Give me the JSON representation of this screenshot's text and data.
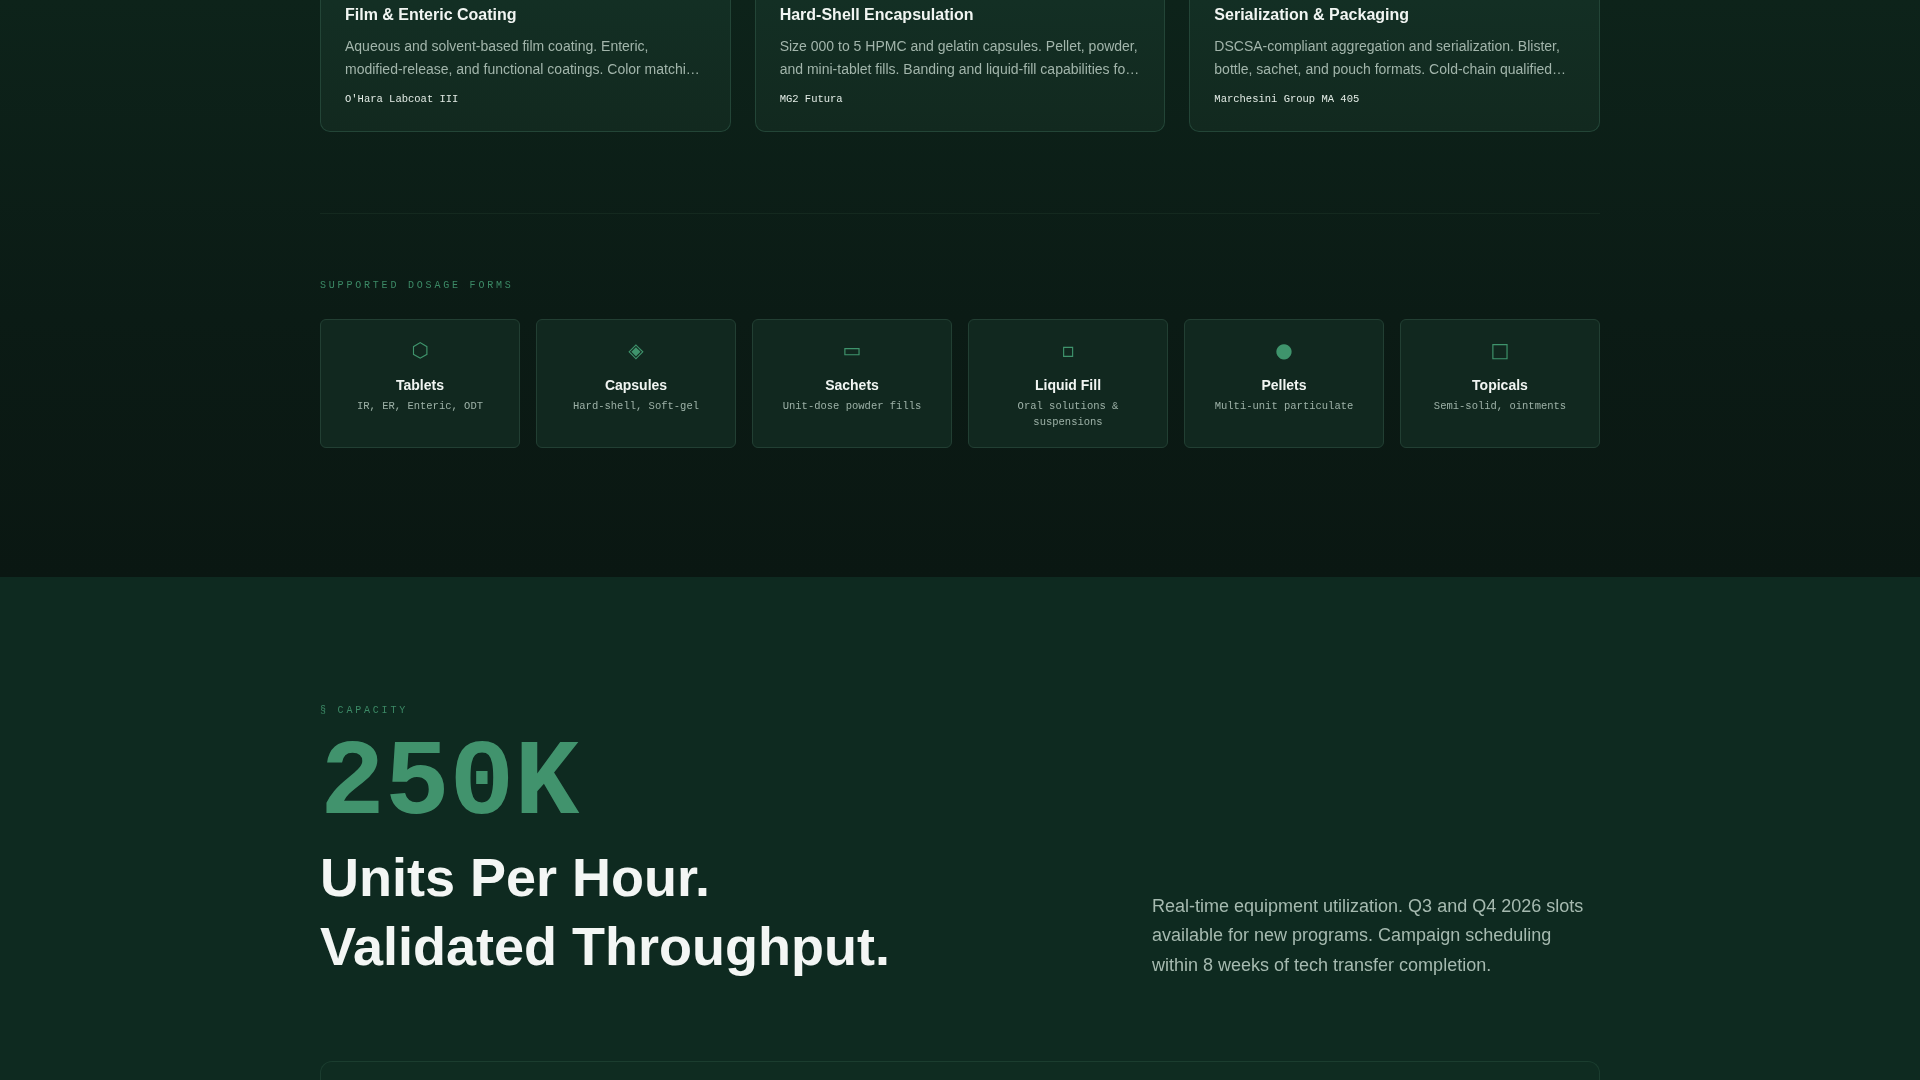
{
  "capabilities": [
    {
      "title": "Film & Enteric Coating",
      "description": "Aqueous and solvent-based film coating. Enteric, modified-release, and functional coatings. Color matchi…",
      "equipment": "O'Hara Labcoat III"
    },
    {
      "title": "Hard-Shell Encapsulation",
      "description": "Size 000 to 5 HPMC and gelatin capsules. Pellet, powder, and mini-tablet fills. Banding and liquid-fill capabilities fo…",
      "equipment": "MG2 Futura"
    },
    {
      "title": "Serialization & Packaging",
      "description": "DSCSA-compliant aggregation and serialization. Blister, bottle, sachet, and pouch formats. Cold-chain qualified…",
      "equipment": "Marchesini Group MA 405"
    }
  ],
  "dosage_forms": {
    "heading": "SUPPORTED DOSAGE FORMS",
    "items": [
      {
        "icon": "⬡",
        "name": "Tablets",
        "description": "IR, ER, Enteric, ODT"
      },
      {
        "icon": "◈",
        "name": "Capsules",
        "description": "Hard-shell, Soft-gel"
      },
      {
        "icon": "▭",
        "name": "Sachets",
        "description": "Unit-dose powder fills"
      },
      {
        "icon": "▫",
        "name": "Liquid Fill",
        "description": "Oral solutions & suspensions"
      },
      {
        "icon": "●",
        "name": "Pellets",
        "description": "Multi-unit particulate"
      },
      {
        "icon": "□",
        "name": "Topicals",
        "description": "Semi-solid, ointments"
      }
    ]
  },
  "capacity": {
    "eyebrow": "§ CAPACITY",
    "figure": "250K",
    "headline_lines": [
      "Units Per Hour.",
      "Validated Throughput."
    ],
    "description": "Real-time equipment utilization. Q3 and Q4 2026 slots available for new programs. Campaign scheduling within 8 weeks of tech transfer completion."
  }
}
